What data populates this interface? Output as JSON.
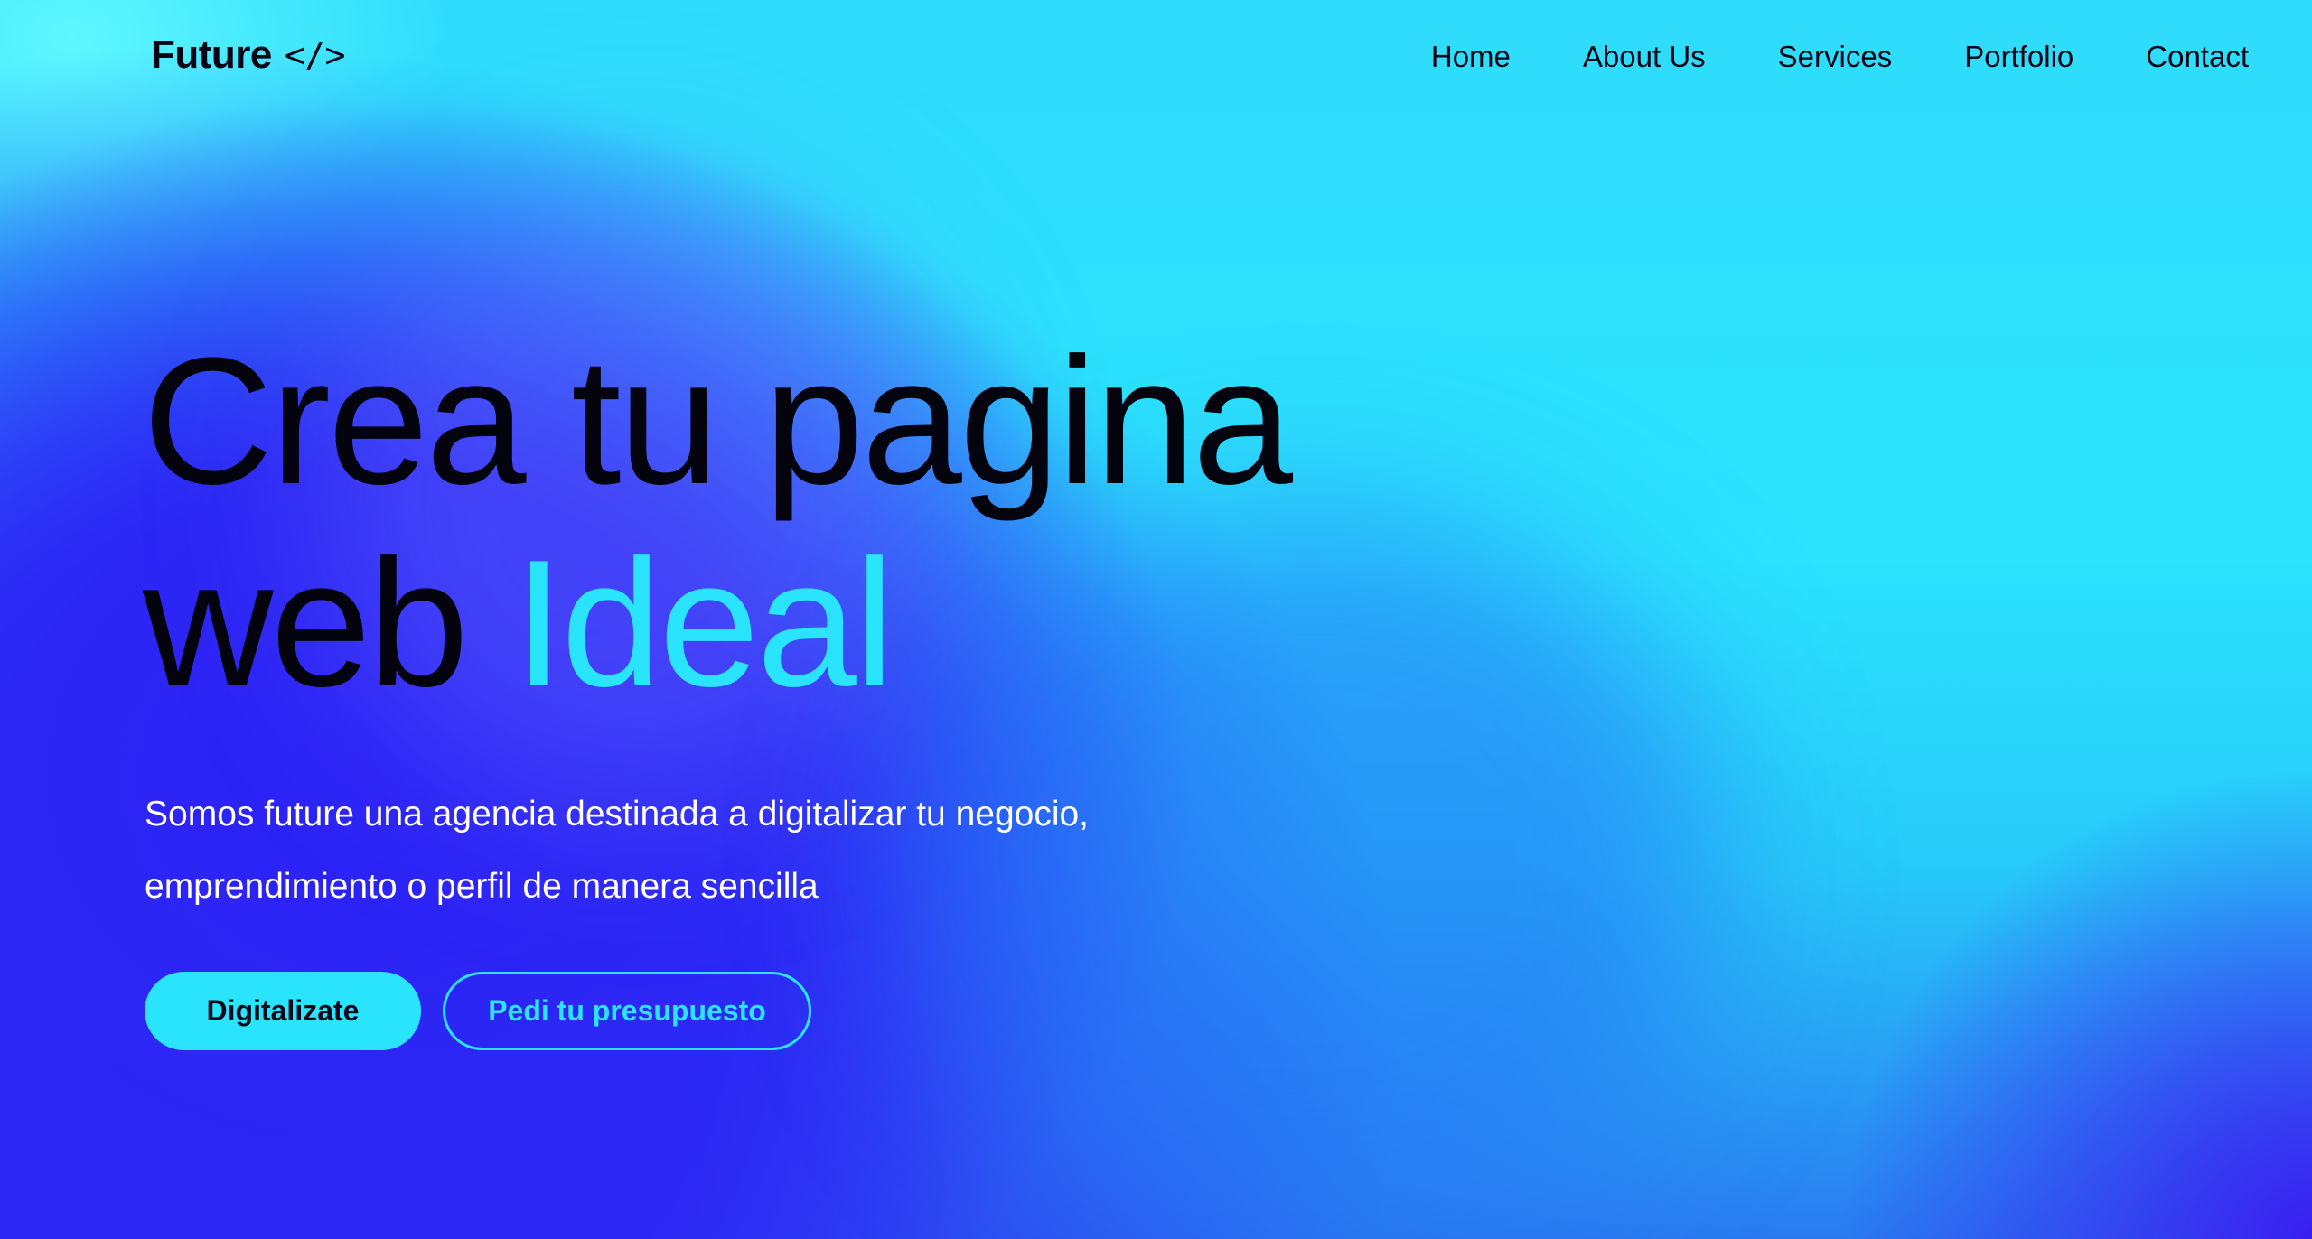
{
  "brand": {
    "name": "Future",
    "code_glyph": "</>"
  },
  "nav": {
    "items": [
      {
        "label": "Home"
      },
      {
        "label": "About Us"
      },
      {
        "label": "Services"
      },
      {
        "label": "Portfolio"
      },
      {
        "label": "Contact"
      }
    ]
  },
  "hero": {
    "title_line1": "Crea tu pagina",
    "title_line2_part1": "web",
    "title_line2_accent": "Ideal",
    "subtitle_line1": "Somos future una agencia destinada a digitalizar tu negocio,",
    "subtitle_line2": "emprendimiento o perfil de manera sencilla",
    "primary_button": "Digitalizate",
    "secondary_button": "Pedi tu presupuesto"
  },
  "colors": {
    "accent": "#2ae3fc",
    "deep_blue": "#2c27f5",
    "text_dark": "#04040e",
    "text_light": "#ffffff"
  }
}
